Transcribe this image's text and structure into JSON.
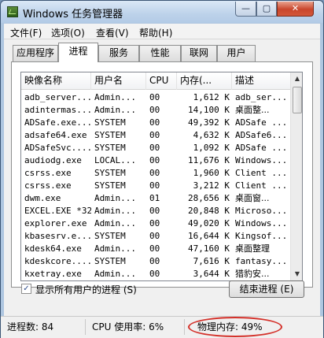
{
  "window": {
    "title": "Windows 任务管理器",
    "minimize": "—",
    "maximize": "▢",
    "close": "✕"
  },
  "menu": [
    "文件(F)",
    "选项(O)",
    "查看(V)",
    "帮助(H)"
  ],
  "tabs": [
    "应用程序",
    "进程",
    "服务",
    "性能",
    "联网",
    "用户"
  ],
  "active_tab": "进程",
  "columns": [
    "映像名称",
    "用户名",
    "CPU",
    "内存(...",
    "描述"
  ],
  "processes": [
    {
      "name": "adb_server...",
      "user": "Admin...",
      "cpu": "00",
      "mem": "1,612 K",
      "desc": "adb_ser..."
    },
    {
      "name": "adintermas...",
      "user": "Admin...",
      "cpu": "00",
      "mem": "14,100 K",
      "desc": "桌面整..."
    },
    {
      "name": "ADSafe.exe...",
      "user": "SYSTEM",
      "cpu": "00",
      "mem": "49,392 K",
      "desc": "ADSafe ..."
    },
    {
      "name": "adsafe64.exe",
      "user": "SYSTEM",
      "cpu": "00",
      "mem": "4,632 K",
      "desc": "ADSafe6..."
    },
    {
      "name": "ADSafeSvc....",
      "user": "SYSTEM",
      "cpu": "00",
      "mem": "1,092 K",
      "desc": "ADSafe ..."
    },
    {
      "name": "audiodg.exe",
      "user": "LOCAL...",
      "cpu": "00",
      "mem": "11,676 K",
      "desc": "Windows..."
    },
    {
      "name": "csrss.exe",
      "user": "SYSTEM",
      "cpu": "00",
      "mem": "1,960 K",
      "desc": "Client ..."
    },
    {
      "name": "csrss.exe",
      "user": "SYSTEM",
      "cpu": "00",
      "mem": "3,212 K",
      "desc": "Client ..."
    },
    {
      "name": "dwm.exe",
      "user": "Admin...",
      "cpu": "01",
      "mem": "28,656 K",
      "desc": "桌面窗..."
    },
    {
      "name": "EXCEL.EXE *32",
      "user": "Admin...",
      "cpu": "00",
      "mem": "20,848 K",
      "desc": "Microso..."
    },
    {
      "name": "explorer.exe",
      "user": "Admin...",
      "cpu": "00",
      "mem": "49,020 K",
      "desc": "Windows..."
    },
    {
      "name": "kbasesrv.e...",
      "user": "SYSTEM",
      "cpu": "00",
      "mem": "16,644 K",
      "desc": "Kingsof..."
    },
    {
      "name": "kdesk64.exe",
      "user": "Admin...",
      "cpu": "00",
      "mem": "47,160 K",
      "desc": "桌面整理"
    },
    {
      "name": "kdeskcore....",
      "user": "SYSTEM",
      "cpu": "00",
      "mem": "7,616 K",
      "desc": "fantasy..."
    },
    {
      "name": "kxetray.exe",
      "user": "Admin...",
      "cpu": "00",
      "mem": "3,644 K",
      "desc": "猎豹安..."
    }
  ],
  "show_all_users": {
    "checked": true,
    "label": "显示所有用户的进程 (S)",
    "mark": "✓"
  },
  "end_process_label": "结束进程 (E)",
  "status": {
    "processes": "进程数: 84",
    "cpu_usage": "CPU 使用率: 6%",
    "physical_memory": "物理内存: 49%"
  },
  "highlight_color": "#d4312a",
  "scroll_up": "▲",
  "scroll_down": "▼"
}
